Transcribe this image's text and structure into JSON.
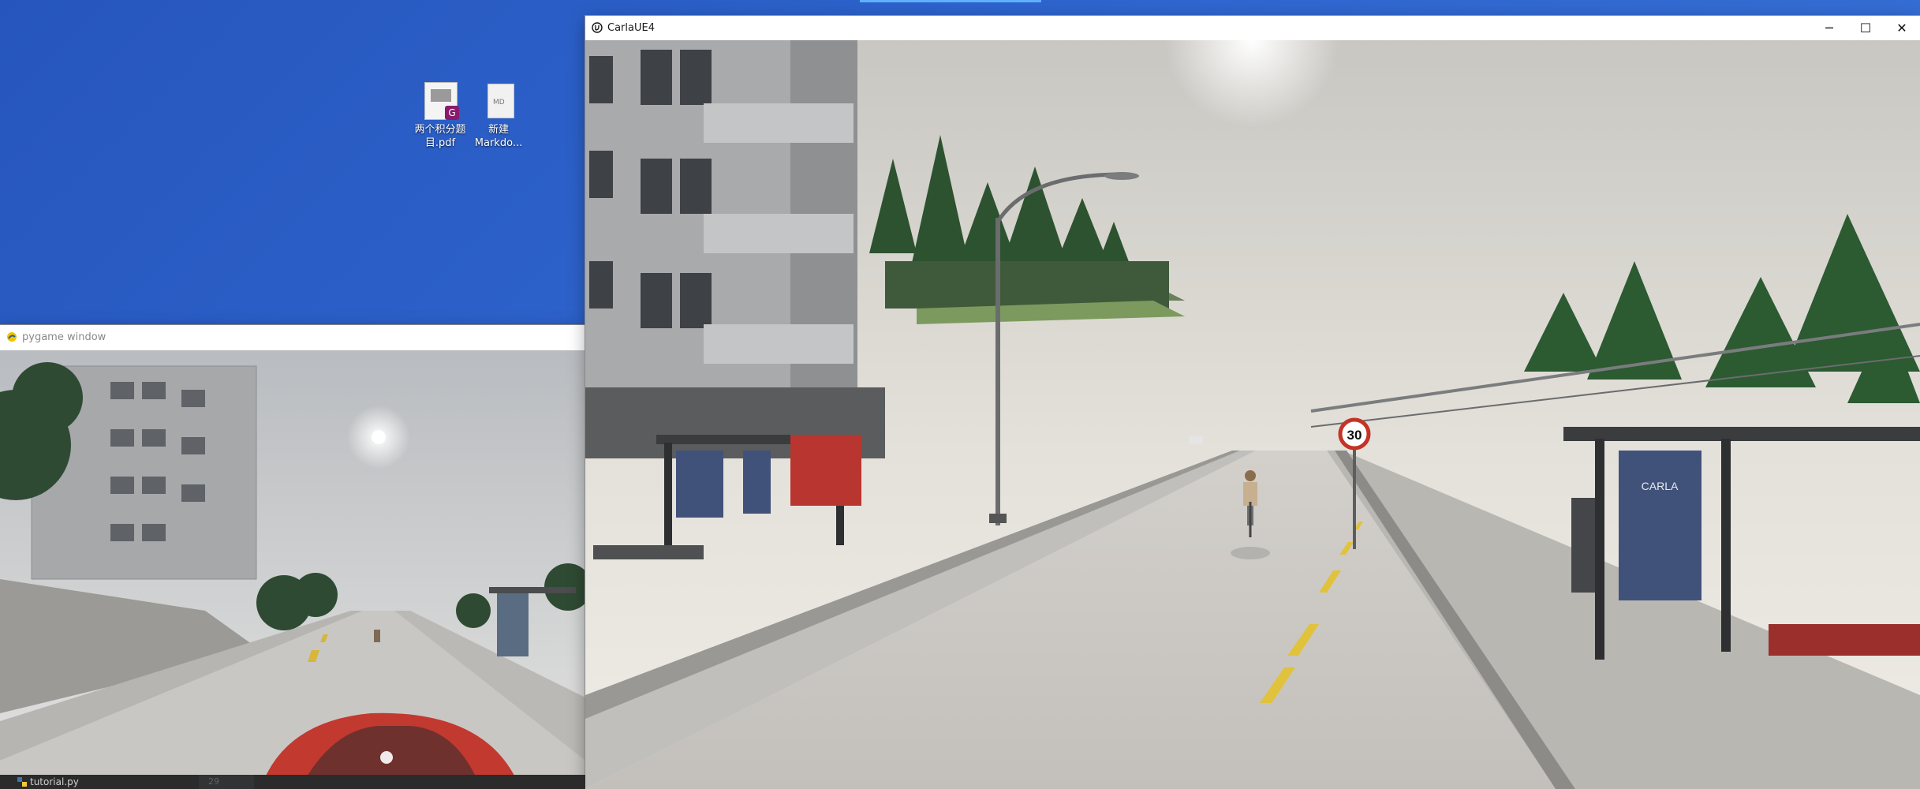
{
  "desktop": {
    "icons": [
      {
        "label": "两个积分题目.pdf",
        "icon": "pdf-file-icon",
        "badge": "G"
      },
      {
        "label": "新建 Markdo...",
        "icon": "markdown-file-icon"
      }
    ]
  },
  "carla_window": {
    "title": "CarlaUE4",
    "app_icon": "unreal-engine-icon",
    "controls": {
      "minimize": "─",
      "maximize": "☐",
      "close": "✕"
    },
    "scene": {
      "speed_sign": "30",
      "poster_text": "CARLA"
    }
  },
  "pygame_window": {
    "title": "pygame window",
    "app_icon": "pygame-snake-icon"
  },
  "editor": {
    "tab_label": "tutorial.py",
    "line_number": "29"
  }
}
